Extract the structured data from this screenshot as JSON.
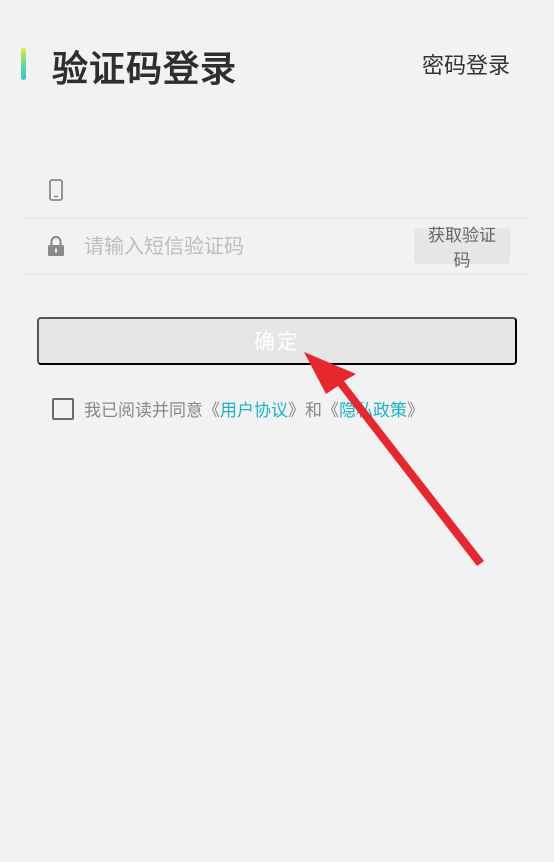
{
  "header": {
    "title": "验证码登录",
    "switch_label": "密码登录"
  },
  "form": {
    "phone_value": "",
    "code_placeholder": "请输入短信验证码",
    "get_code_label": "获取验证码"
  },
  "confirm_label": "确定",
  "agreement": {
    "prefix": "我已阅读并同意《",
    "user_agreement": "用户协议",
    "middle": "》和《",
    "privacy_policy": "隐私政策",
    "suffix": "》",
    "checked": false
  },
  "colors": {
    "background": "#f2f2f2",
    "accent_link": "#18b3c8",
    "disabled_button": "#e6e6e6",
    "annotation_arrow": "#e8262e"
  }
}
